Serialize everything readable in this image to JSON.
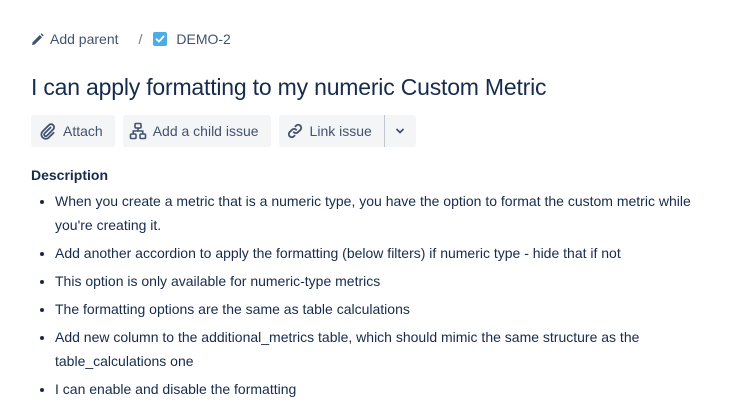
{
  "breadcrumb": {
    "add_parent_label": "Add parent",
    "separator": "/",
    "issue_key": "DEMO-2"
  },
  "issue": {
    "title": "I can apply formatting to my numeric Custom Metric"
  },
  "toolbar": {
    "attach_label": "Attach",
    "add_child_label": "Add a child issue",
    "link_issue_label": "Link issue"
  },
  "description": {
    "label": "Description",
    "items": [
      "When you create a metric that is a numeric type, you have the option to format the custom metric while you're creating it.",
      "Add another accordion to apply the formatting (below filters) if numeric type - hide that if not",
      "This option is only available for numeric-type metrics",
      "The formatting options are the same as table calculations",
      "Add new column to the additional_metrics table, which should mimic the same structure as the table_calculations one",
      "I can enable and disable the formatting"
    ]
  },
  "colors": {
    "text_primary": "#172b4d",
    "text_secondary": "#42526e",
    "button_bg": "#f4f5f7",
    "checkbox_blue": "#4bade8"
  },
  "icons": {
    "add_parent": "pencil-icon",
    "issue_type": "checkbox-icon",
    "attach": "paperclip-icon",
    "add_child": "hierarchy-icon",
    "link": "link-icon",
    "more": "chevron-down-icon"
  }
}
